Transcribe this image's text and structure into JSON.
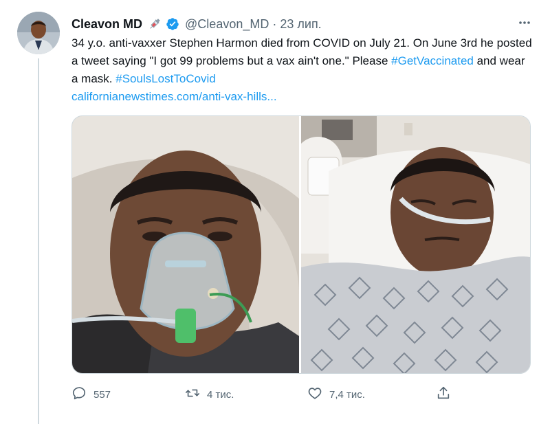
{
  "author": {
    "name": "Cleavon MD",
    "emoji_icon": "syringe-icon",
    "verified_icon": "verified-badge-icon",
    "handle": "@Cleavon_MD",
    "separator": "·",
    "time": "23 лип."
  },
  "more_icon": "more-horizontal-icon",
  "text": {
    "part1": "34 y.o. anti-vaxxer Stephen Harmon died from COVID on July 21. On June 3rd he posted a tweet saying \"I got 99 problems but a vax ain't one.\" Please ",
    "hashtag1": "#GetVaccinated",
    "part2": " and wear a mask. ",
    "hashtag2": "#SoulsLostToCovid",
    "url": "californianewstimes.com/anti-vax-hills..."
  },
  "media": [
    {
      "name": "photo-man-oxygen-mask"
    },
    {
      "name": "photo-man-hospital-bed"
    }
  ],
  "actions": {
    "reply": {
      "icon": "reply-icon",
      "count": "557"
    },
    "retweet": {
      "icon": "retweet-icon",
      "count": "4 тис."
    },
    "like": {
      "icon": "like-heart-icon",
      "count": "7,4 тис."
    },
    "share": {
      "icon": "share-icon"
    }
  },
  "colors": {
    "link": "#1d9bf0",
    "secondary_text": "#536471",
    "primary_text": "#0f1419",
    "verified": "#1d9bf0"
  }
}
